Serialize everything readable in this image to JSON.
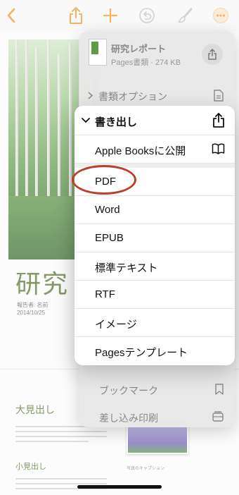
{
  "document": {
    "title": "研究レポート",
    "title_visible": "研究レ",
    "meta_line1": "報告者: 名前",
    "meta_line2": "2014/10/25",
    "heading_big": "大見出し",
    "heading_small": "小見出し",
    "image_caption": "写真のキャプション"
  },
  "share_menu": {
    "file_name": "研究レポート",
    "file_info": "Pages書類 · 274 KB",
    "document_options": "書類オプション",
    "bookmark": "ブックマーク",
    "mail_merge": "差し込み印刷"
  },
  "export_menu": {
    "header": "書き出し",
    "items": [
      {
        "label": "Apple Booksに公開",
        "icon": "book-icon"
      },
      {
        "label": "PDF"
      },
      {
        "label": "Word"
      },
      {
        "label": "EPUB"
      },
      {
        "label": "標準テキスト"
      },
      {
        "label": "RTF"
      },
      {
        "label": "イメージ"
      },
      {
        "label": "Pagesテンプレート"
      }
    ]
  },
  "colors": {
    "accent": "#f28c1b",
    "highlight_ring": "#b8412d",
    "doc_green": "#4a6b22"
  }
}
